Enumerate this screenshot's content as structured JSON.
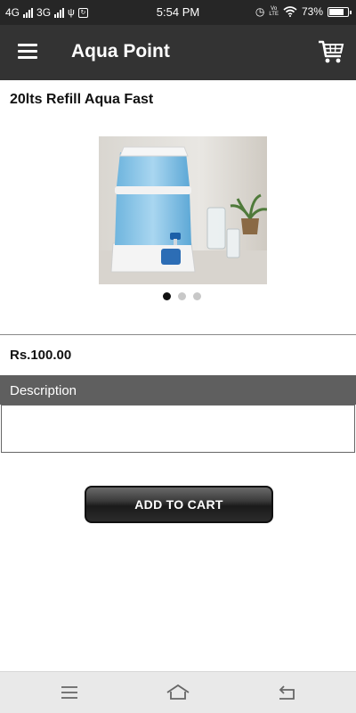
{
  "status_bar": {
    "net1": "4G",
    "net2": "3G",
    "time": "5:54 PM",
    "battery": "73%",
    "volte_top": "Vo",
    "volte_bottom": "LTE"
  },
  "app_bar": {
    "title": "Aqua Point",
    "menu_icon": "hamburger-menu-icon",
    "cart_icon": "shopping-cart-icon"
  },
  "product": {
    "name": "20lts Refill Aqua Fast",
    "price": "Rs.100.00",
    "image": "water-purifier-photo",
    "carousel_active_index": 0,
    "carousel_count": 3
  },
  "description": {
    "header": "Description",
    "text": ""
  },
  "actions": {
    "add_to_cart": "ADD TO CART"
  },
  "nav_bar": {
    "icons": [
      "recents-icon",
      "home-icon",
      "back-icon"
    ]
  },
  "colors": {
    "app_bar": "#333333",
    "status_bar": "#262626",
    "section_header": "#5f5f5f",
    "button": "#1a1a1a"
  }
}
